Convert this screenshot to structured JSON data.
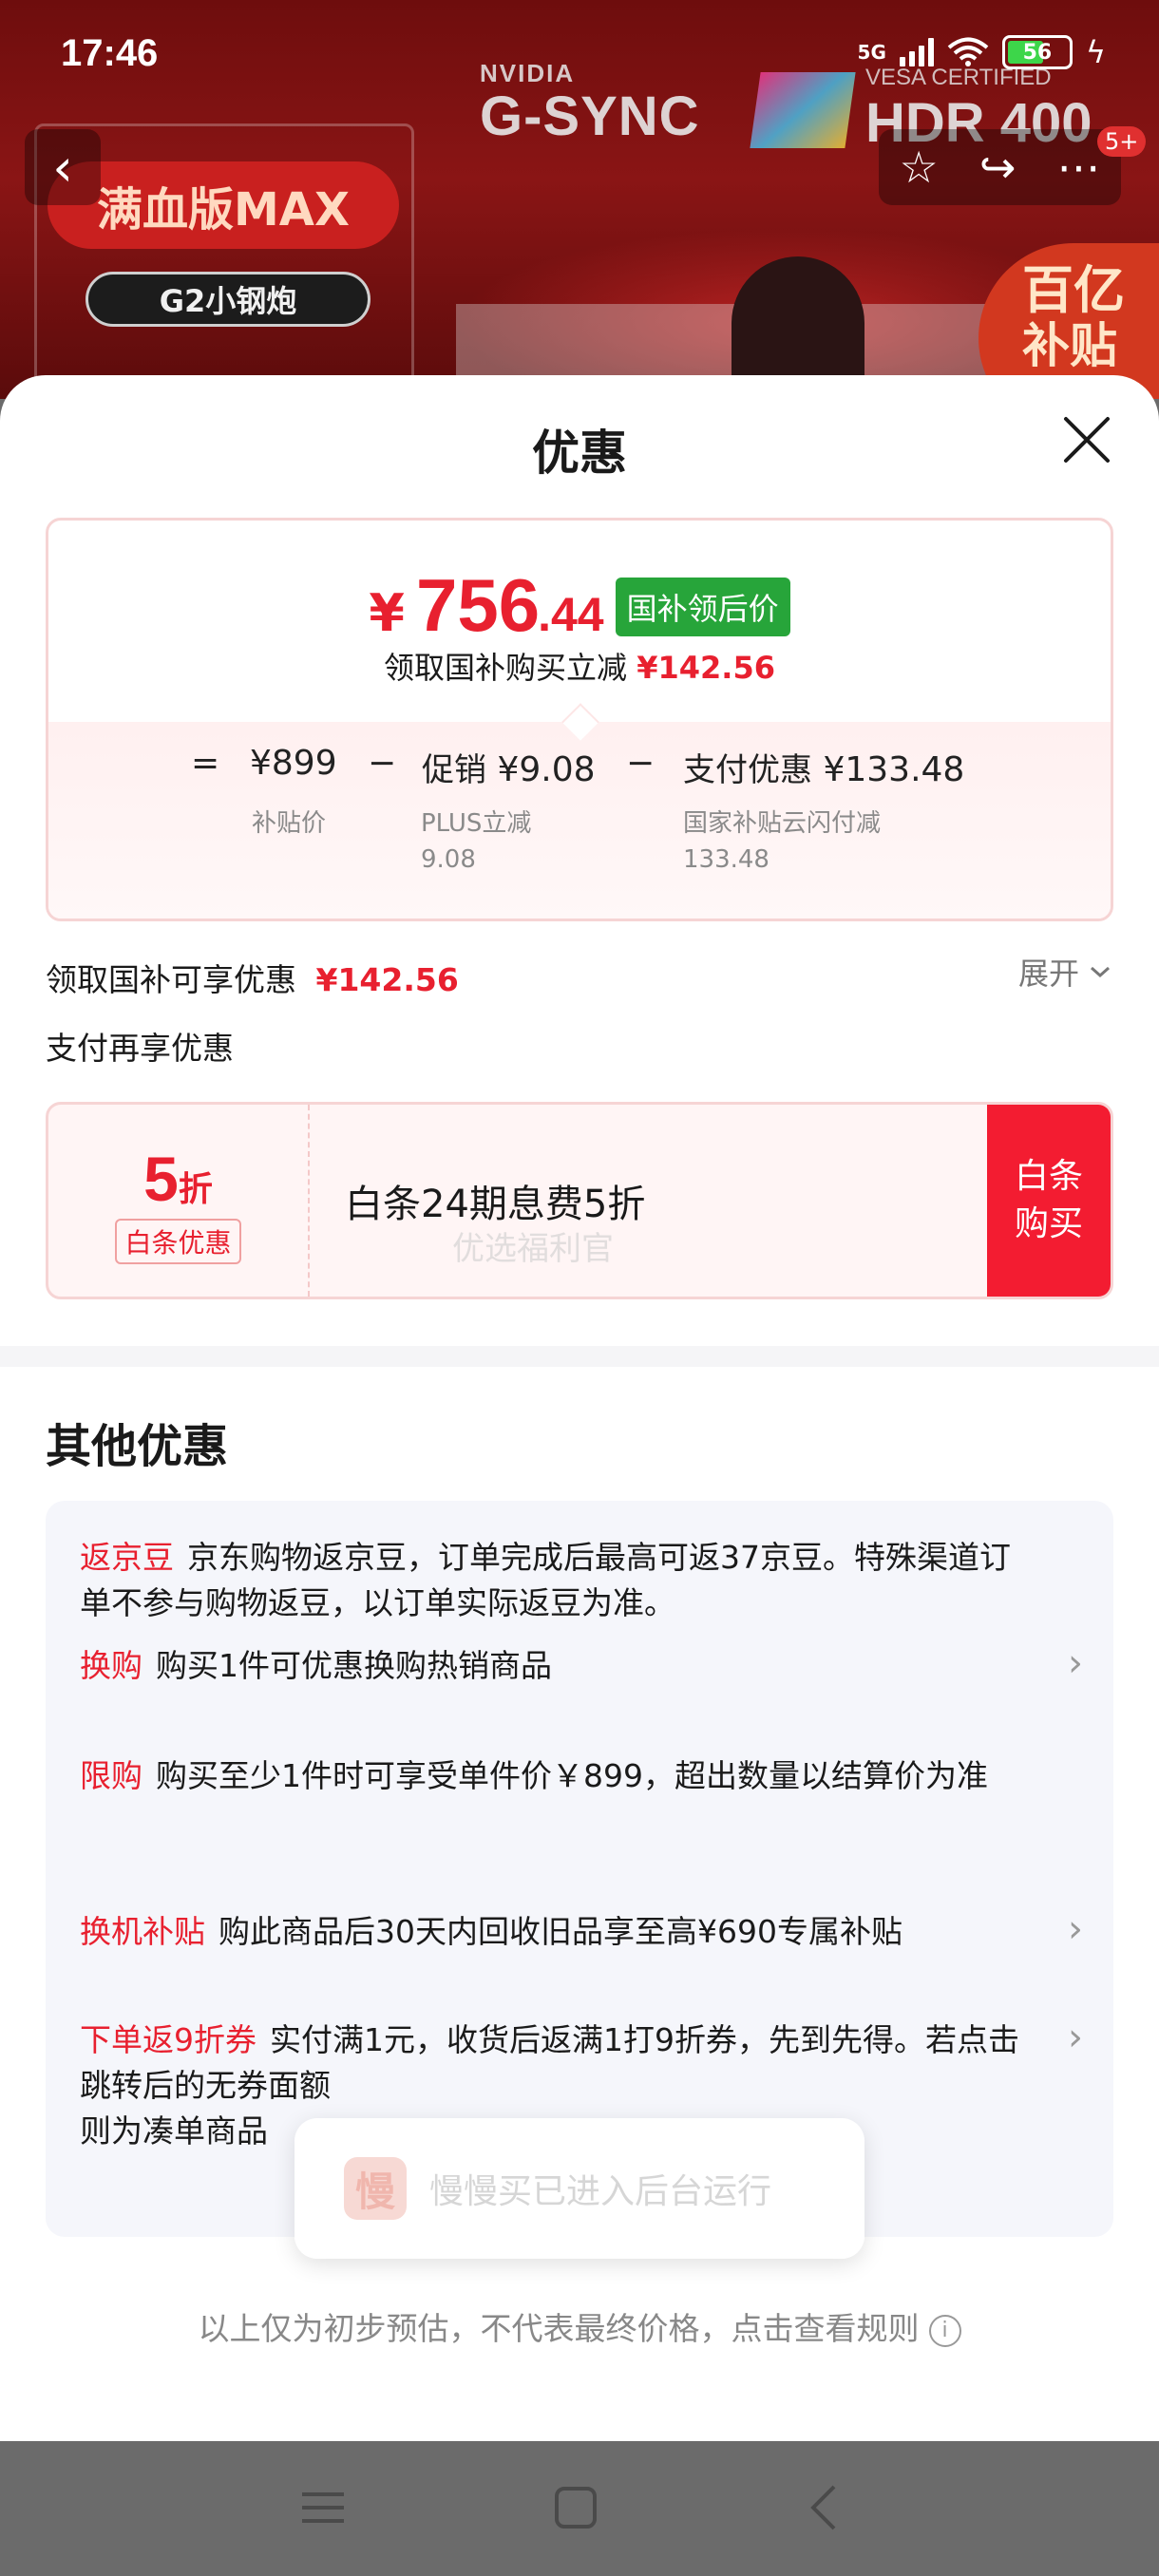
{
  "status_bar": {
    "time": "17:46",
    "signal": "5G",
    "battery": "56"
  },
  "banner": {
    "nvidia_brand": "NVIDIA",
    "gsync": "G-SYNC",
    "vesa_certified": "VESA CERTIFIED",
    "hdr": "HDR 400",
    "promo_max": "满血版MAX",
    "promo_g2": "G2小钢炮",
    "subsidy_line1": "百亿",
    "subsidy_line2": "补贴",
    "badge_count": "5+"
  },
  "sheet": {
    "title": "优惠",
    "price_card": {
      "currency": "¥",
      "final_int": "756",
      "final_dec": ".44",
      "tag": "国补领后价",
      "reduce_label": "领取国补购买立减",
      "reduce_value": "¥142.56",
      "formula": {
        "eq": "=",
        "base_value": "¥899",
        "base_label": "补贴价",
        "minus1": "−",
        "promo_label": "促销",
        "promo_value": "¥9.08",
        "promo_sub1": "PLUS立减",
        "promo_sub2": "9.08",
        "minus2": "−",
        "pay_label": "支付优惠",
        "pay_value": "¥133.48",
        "pay_sub1": "国家补贴云闪付减",
        "pay_sub2": "133.48"
      }
    },
    "guobu_label": "领取国补可享优惠",
    "guobu_value": "¥142.56",
    "expand_label": "展开",
    "pay_again_label": "支付再享优惠",
    "baitiao": {
      "discount_num": "5",
      "discount_unit": "折",
      "tag": "白条优惠",
      "desc": "白条24期息费5折",
      "watermark": "优选福利官",
      "buy_label_1": "白条",
      "buy_label_2": "购买"
    },
    "other_title": "其他优惠",
    "offers": [
      {
        "tag": "返京豆",
        "text": "京东购物返京豆，订单完成后最高可返37京豆。特殊渠道订单不参与购物返豆，以订单实际返豆为准。"
      },
      {
        "tag": "换购",
        "text": "购买1件可优惠换购热销商品"
      },
      {
        "tag": "限购",
        "text": "购买至少1件时可享受单件价￥899，超出数量以结算价为准"
      },
      {
        "tag": "换机补贴",
        "text": "购此商品后30天内回收旧品享至高¥690专属补贴"
      },
      {
        "tag": "下单返9折券",
        "text": "实付满1元，收货后返满1打9折券，先到先得。若点击跳转后的",
        "text_tail": "无券面额",
        "text_line3": "则为凑单商品"
      }
    ],
    "toast": {
      "icon_char": "慢",
      "message": "慢慢买已进入后台运行"
    },
    "disclaimer": "以上仅为初步预估，不代表最终价格，点击查看规则"
  },
  "colors": {
    "accent_red": "#e8202f",
    "tag_green": "#27a53a",
    "buy_red": "#f31c31"
  }
}
